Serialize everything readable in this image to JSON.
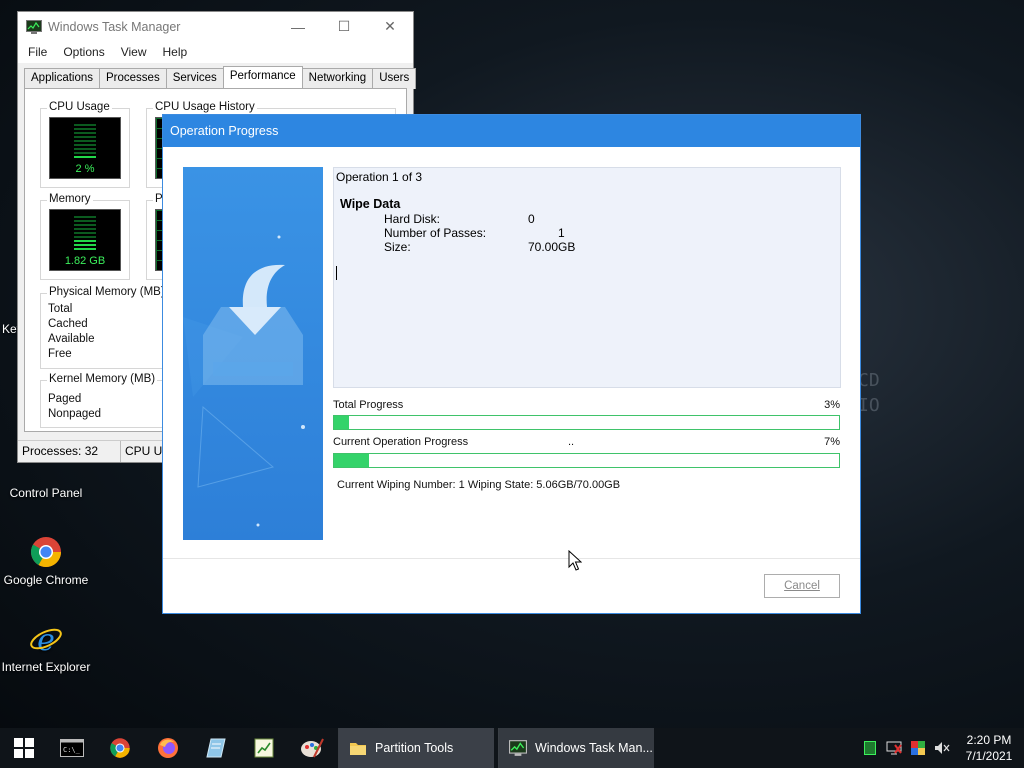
{
  "desktop": {
    "bg_text": [
      "CD",
      "IO"
    ],
    "partial_icon_label": "Key",
    "icons": [
      {
        "label": "Control Panel",
        "icon": "control-panel-icon"
      },
      {
        "label": "Google Chrome",
        "icon": "chrome-icon"
      },
      {
        "label": "Internet Explorer",
        "icon": "internet-explorer-icon"
      }
    ]
  },
  "task_manager": {
    "title": "Windows Task Manager",
    "menu": [
      "File",
      "Options",
      "View",
      "Help"
    ],
    "tabs": [
      "Applications",
      "Processes",
      "Services",
      "Performance",
      "Networking",
      "Users"
    ],
    "active_tab": "Performance",
    "cpu_usage_label": "CPU Usage",
    "cpu_usage_value": "2 %",
    "cpu_history_label": "CPU Usage History",
    "memory_label": "Memory",
    "memory_value": "1.82 GB",
    "memory_history_label_partial": "Ph",
    "physical_memory": {
      "title": "Physical Memory (MB)",
      "rows": [
        "Total",
        "Cached",
        "Available",
        "Free"
      ]
    },
    "kernel_memory": {
      "title": "Kernel Memory (MB)",
      "rows": [
        "Paged",
        "Nonpaged"
      ]
    },
    "status": {
      "processes": "Processes: 32",
      "cpu_partial": "CPU U"
    }
  },
  "dialog": {
    "title": "Operation Progress",
    "operation": "Operation 1 of 3",
    "op_name": "Wipe Data",
    "details": [
      {
        "key": "Hard Disk:",
        "value": "0"
      },
      {
        "key": "Number of Passes:",
        "value": "         1"
      },
      {
        "key": "Size:",
        "value": "70.00GB"
      }
    ],
    "total_progress": {
      "label": "Total Progress",
      "percent_text": "3%",
      "fraction": 0.03
    },
    "current_progress": {
      "label": "Current Operation Progress",
      "middle": "..",
      "percent_text": "7%",
      "fraction": 0.07
    },
    "wipe_info": "Current Wiping Number: 1  Wiping State: 5.06GB/70.00GB",
    "cancel_label": "Cancel"
  },
  "taskbar": {
    "pinned": [
      "start-icon",
      "cmd-icon",
      "chrome-icon",
      "firefox-icon",
      "notepad-icon",
      "spreadsheet-icon",
      "paint-icon"
    ],
    "buttons": [
      {
        "label": "Partition Tools",
        "icon": "folder-icon"
      },
      {
        "label": "Windows Task Man...",
        "icon": "task-manager-icon"
      }
    ],
    "clock_time": "2:20 PM",
    "clock_date": "7/1/2021"
  },
  "colors": {
    "accent": "#2d86e1",
    "progress_fill": "#34d36a",
    "meter_green": "#3cf05c"
  }
}
